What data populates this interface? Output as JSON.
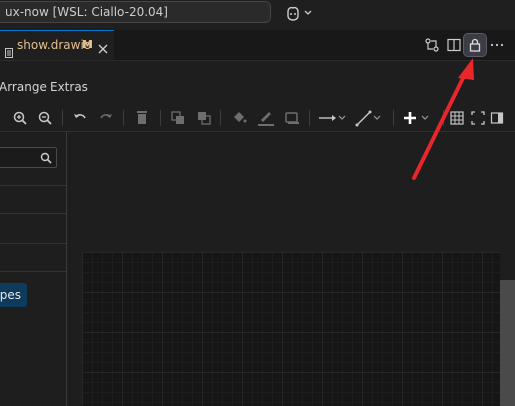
{
  "titlebar": {
    "command_center_text": "ux-now [WSL: Ciallo-20.04]",
    "copilot_icon": "copilot-icon"
  },
  "tabs": [
    {
      "label": "show.drawio",
      "modified_badge": "M",
      "icon": "file-icon",
      "close_icon": "close-icon"
    }
  ],
  "editor_actions": [
    "git-compare-icon",
    "split-editor-icon",
    "lock-icon",
    "more-icon"
  ],
  "menu": {
    "arrange": "Arrange",
    "extras": "Extras"
  },
  "toolbar_icons": [
    "zoom-in-icon",
    "zoom-out-icon",
    "undo-icon",
    "redo-icon",
    "delete-icon",
    "to-front-icon",
    "to-back-icon",
    "fill-color-icon",
    "line-color-icon",
    "shadow-icon",
    "connection-icon",
    "waypoints-icon",
    "insert-icon",
    "table-icon",
    "fullscreen-icon",
    "format-panel-icon"
  ],
  "sidebar": {
    "search_placeholder": "",
    "shapes_button": "pes"
  },
  "colors": {
    "tab_accent": "#0078d4",
    "modified_text": "#e2c08d",
    "annotation_arrow": "#e8262b",
    "shapes_button": "#0e3a5c"
  }
}
